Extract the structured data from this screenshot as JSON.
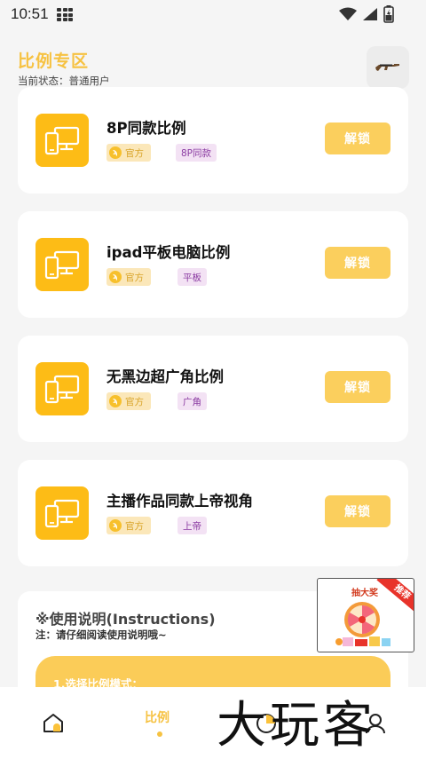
{
  "statusbar": {
    "time": "10:51"
  },
  "header": {
    "title": "比例专区",
    "status": "当前状态：普通用户"
  },
  "cards": [
    {
      "name": "8P同款比例",
      "official": "官方",
      "tag": "8P同款",
      "unlock": "解锁"
    },
    {
      "name": "ipad平板电脑比例",
      "official": "官方",
      "tag": "平板",
      "unlock": "解锁"
    },
    {
      "name": "无黑边超广角比例",
      "official": "官方",
      "tag": "广角",
      "unlock": "解锁"
    },
    {
      "name": "主播作品同款上帝视角",
      "official": "官方",
      "tag": "上帝",
      "unlock": "解锁"
    }
  ],
  "instructions": {
    "heading": "※使用说明(Instructions)",
    "note": "注：请仔细阅读使用说明哦~",
    "step1": "1.选择比例模式："
  },
  "promo": {
    "title": "抽大奖",
    "ribbon": "推荐"
  },
  "tabbar": {
    "active_label": "比例"
  },
  "watermark": "大玩客",
  "colors": {
    "accent": "#f6c242",
    "tile": "#fdbc16",
    "unlock": "#fbcf5d",
    "tag_purple": "#8a3aa1"
  },
  "icons": {
    "header_button": "rifle-icon",
    "card_tile": "devices-icon",
    "tabs": [
      "home-icon",
      "pie-chart-icon",
      "user-icon"
    ]
  }
}
